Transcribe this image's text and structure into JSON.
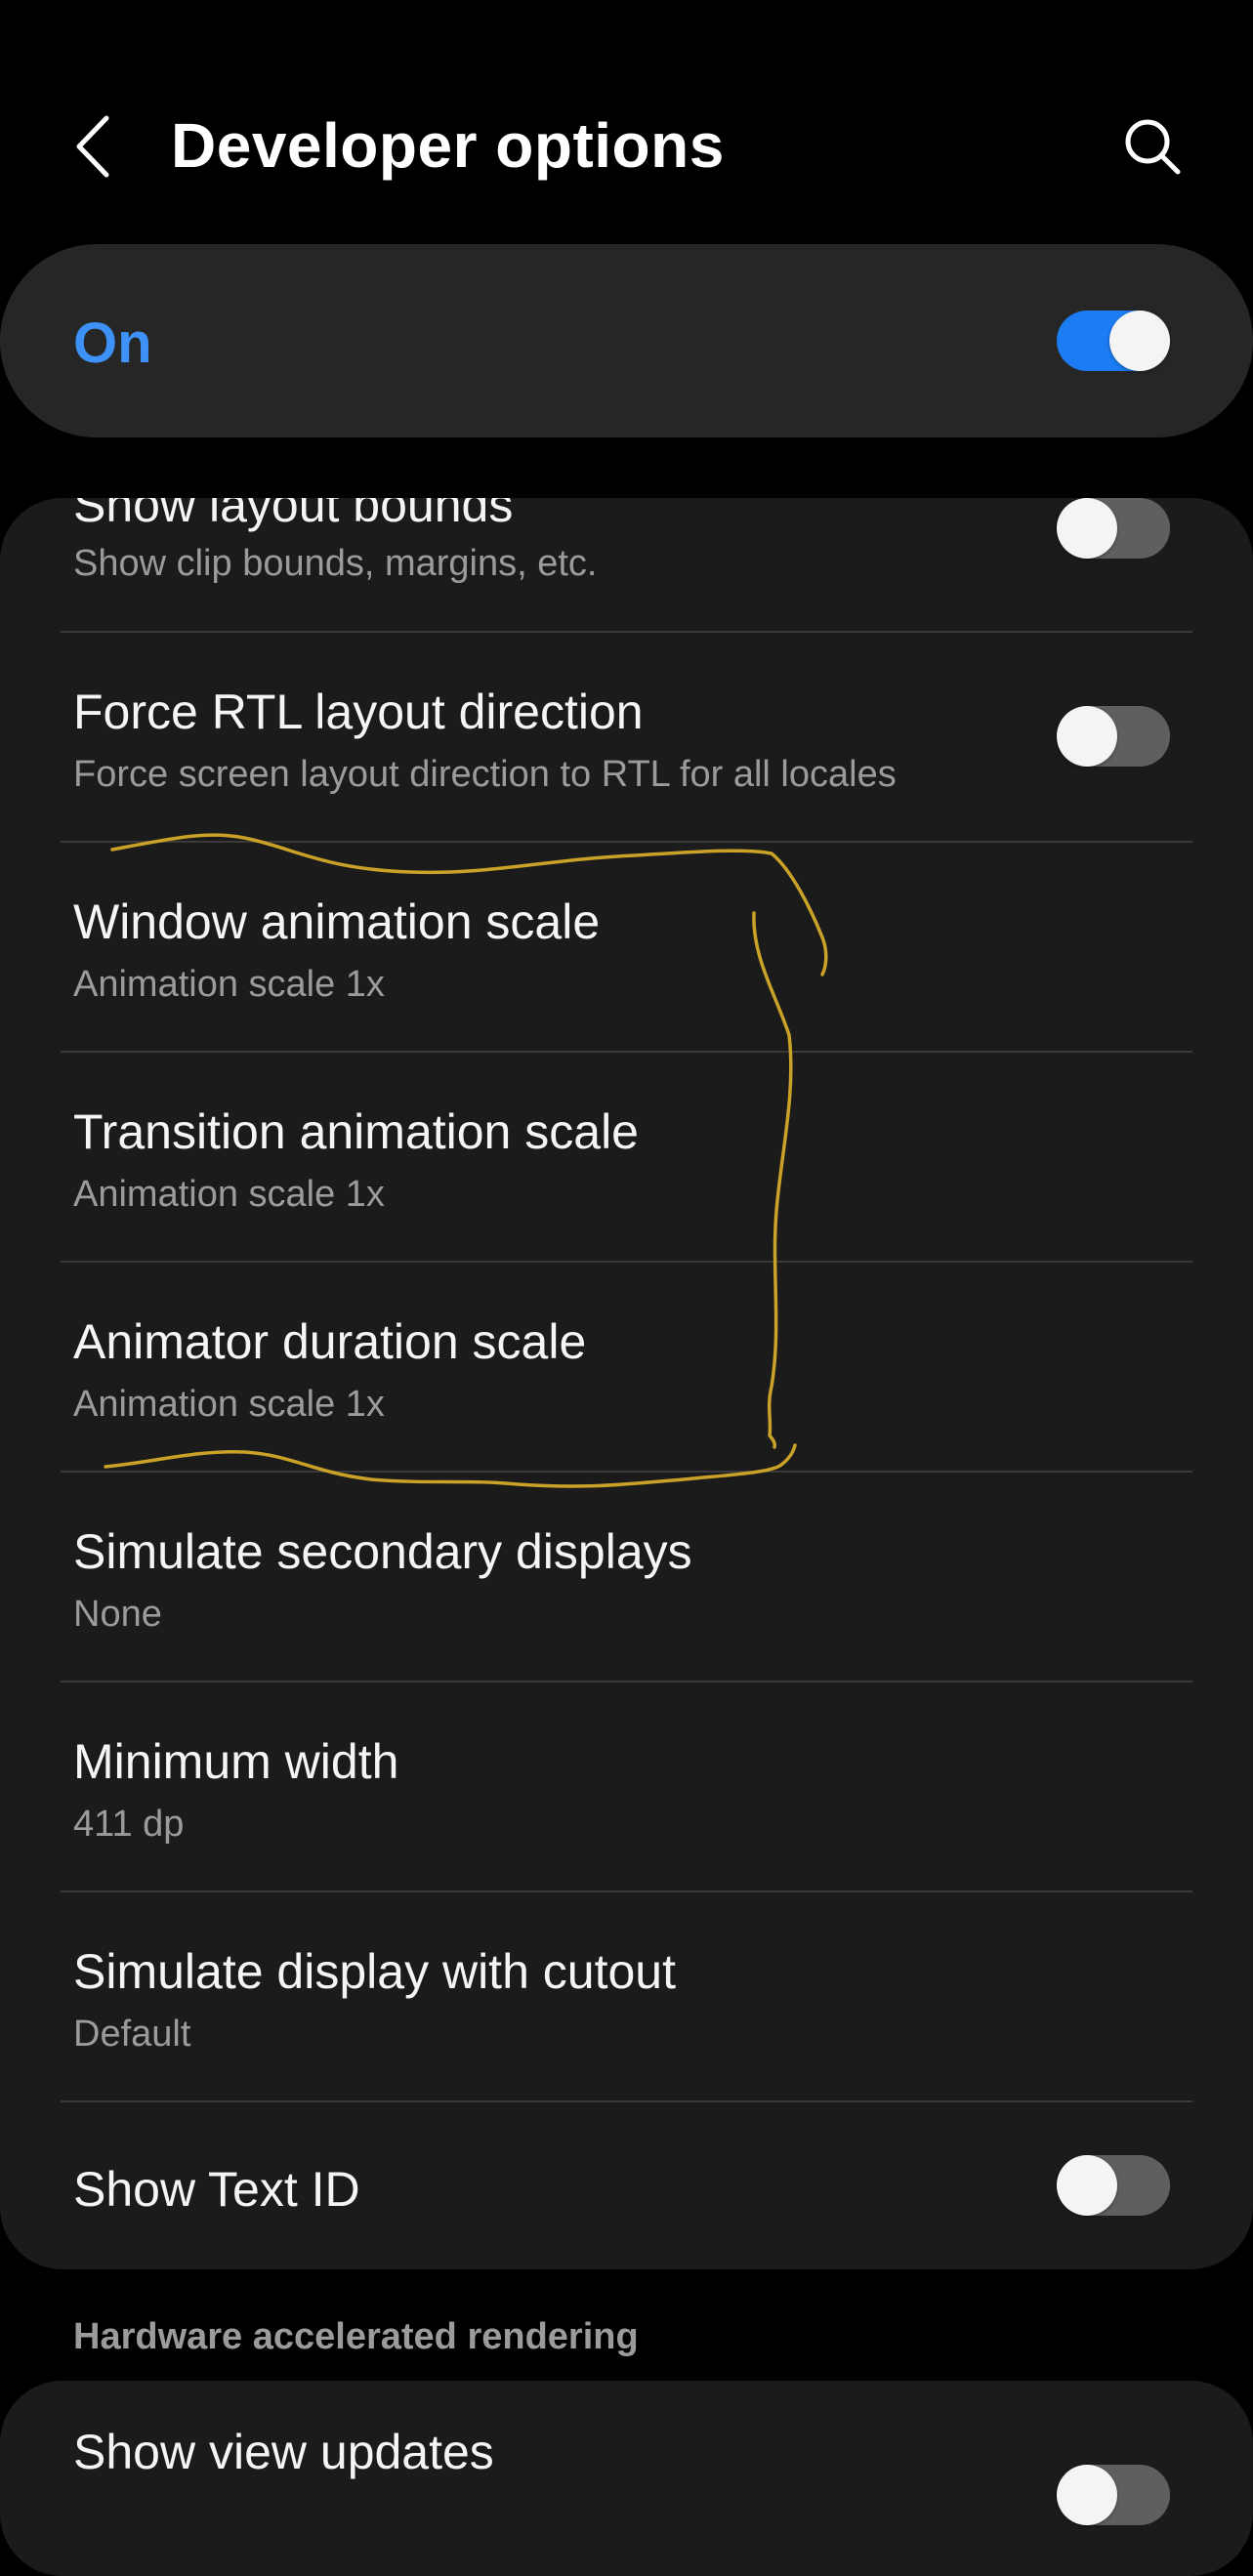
{
  "header": {
    "title": "Developer options",
    "back_icon": "chevron-left-icon",
    "search_icon": "search-icon"
  },
  "master_switch": {
    "label": "On",
    "state": true,
    "accent_color": "#3e91f7"
  },
  "settings": [
    {
      "title": "Show layout bounds",
      "summary": "Show clip bounds, margins, etc.",
      "toggle": false
    },
    {
      "title": "Force RTL layout direction",
      "summary": "Force screen layout direction to RTL for all locales",
      "toggle": false
    },
    {
      "title": "Window animation scale",
      "summary": "Animation scale 1x"
    },
    {
      "title": "Transition animation scale",
      "summary": "Animation scale 1x"
    },
    {
      "title": "Animator duration scale",
      "summary": "Animation scale 1x"
    },
    {
      "title": "Simulate secondary displays",
      "summary": "None"
    },
    {
      "title": "Minimum width",
      "summary": "411 dp"
    },
    {
      "title": "Simulate display with cutout",
      "summary": "Default"
    },
    {
      "title": "Show Text ID",
      "toggle": false
    }
  ],
  "section": {
    "title": "Hardware accelerated rendering"
  },
  "settings_2": [
    {
      "title": "Show view updates",
      "toggle": false
    }
  ],
  "annotation": {
    "color": "#c9a227"
  }
}
